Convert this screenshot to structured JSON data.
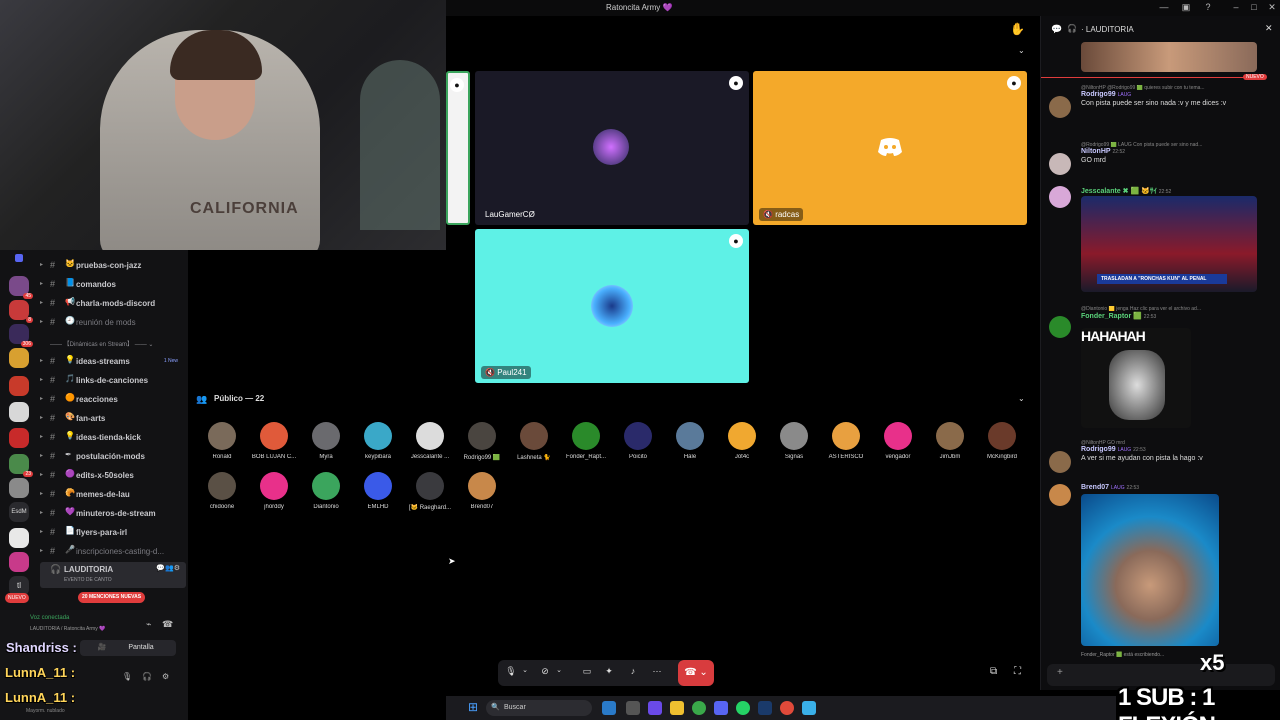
{
  "window": {
    "title": "Ratoncita Army 💜"
  },
  "webcam": {
    "shirt_text": "CALIFORNIA"
  },
  "server_rail": {
    "badges": [
      "45",
      "8",
      "306",
      "23",
      "99",
      "32",
      "",
      "2"
    ],
    "esda_label": "EsdM"
  },
  "channels": [
    {
      "label": "pruebas-con-jazz",
      "icon": "🐱"
    },
    {
      "label": "comandos",
      "icon": "📘"
    },
    {
      "label": "charla-mods-discord",
      "icon": "📢"
    },
    {
      "label": "reunión de mods",
      "icon": "🕘",
      "muted": true
    },
    {
      "label": "ideas-streams",
      "icon": "💡",
      "badge": "1 New"
    },
    {
      "label": "links-de-canciones",
      "icon": "🎵"
    },
    {
      "label": "reacciones",
      "icon": "🟠"
    },
    {
      "label": "fan-arts",
      "icon": "🎨"
    },
    {
      "label": "ideas-tienda-kick",
      "icon": "💡"
    },
    {
      "label": "postulación-mods",
      "icon": "✒"
    },
    {
      "label": "edits-x-50soles",
      "icon": "🟣"
    },
    {
      "label": "memes-de-lau",
      "icon": "🥐"
    },
    {
      "label": "minuteros-de-stream",
      "icon": "💜"
    },
    {
      "label": "flyers-para-irl",
      "icon": "📄"
    },
    {
      "label": "inscripciones-casting-d...",
      "icon": "🎤",
      "muted": true
    }
  ],
  "category_label": "【Dinámicas en Stream】",
  "active_channel": {
    "label": "LAUDITORIA",
    "sub": "EVENTO DE CANTO"
  },
  "mentions_pill": "20 MENCIONES NUEVAS",
  "nuevo_pill": "NUEVO",
  "voice_panel": {
    "connected": "Voz conectada",
    "path": "LAUDITORIA / Ratoncita Army 💜",
    "screen_label": "Pantalla"
  },
  "overlays": {
    "user1": "Shandriss :",
    "user2": "LunnA_11 :",
    "user3": "LunnA_11 :",
    "status": "Mayorm. nublado",
    "sub_flex": "1 SUB : 1 FLEXIÓN",
    "x5": "x5"
  },
  "stage": {
    "tiles": [
      {
        "name": "LauGamerCØ"
      },
      {
        "name": "radcas"
      },
      {
        "name": "Paul241"
      }
    ]
  },
  "audience": {
    "header": "Público — 22",
    "members": [
      {
        "name": "Ronald",
        "color": "#7a6a5a"
      },
      {
        "name": "BOB LUJAN C...",
        "color": "#e05a3a"
      },
      {
        "name": "Myra",
        "color": "#6a6a6e"
      },
      {
        "name": "keypibara",
        "color": "#3aa8c8"
      },
      {
        "name": "Jesscalante ...",
        "color": "#dcdcdc"
      },
      {
        "name": "Rodrigo99 🟩",
        "color": "#4a4540"
      },
      {
        "name": "Lashneta 🐈",
        "color": "#6a4a3a"
      },
      {
        "name": "Fonder_Rapt...",
        "color": "#2a8a2a"
      },
      {
        "name": "Poicito",
        "color": "#2a2a6a"
      },
      {
        "name": "Hale",
        "color": "#5a7a9a"
      },
      {
        "name": "Jot4c",
        "color": "#f0a830"
      },
      {
        "name": "Signas",
        "color": "#8a8a8a"
      },
      {
        "name": "ASTERISCO",
        "color": "#e8a040"
      },
      {
        "name": "vengador",
        "color": "#e8308a"
      },
      {
        "name": "JimJbm",
        "color": "#8a6a4a"
      },
      {
        "name": "McKingbird",
        "color": "#6a3a2a"
      },
      {
        "name": "chidoone",
        "color": "#5a5045"
      },
      {
        "name": "jhorddy",
        "color": "#e8308a"
      },
      {
        "name": "Diantonio",
        "color": "#3ba55d"
      },
      {
        "name": "EMLHD",
        "color": "#3a5ae8"
      },
      {
        "name": "[🐱 Raeghard...",
        "color": "#3a3a3e"
      },
      {
        "name": "Brend07",
        "color": "#c8884a"
      }
    ]
  },
  "chat": {
    "channel": "LAUDITORIA",
    "nuevo": "NUEVO",
    "messages": [
      {
        "reply": "@NiltonHP @Rodrigo99 🟩 quieres subir con tu tema...",
        "author": "Rodrigo99",
        "tag": "LAUG",
        "author_color": "#c8c8ff",
        "text": "Con pista puede ser sino nada :v y me dices :v"
      },
      {
        "reply": "@Rodrigo99 🟩 LAUG Con pista puede ser sino nad...",
        "author": "NiltonHP",
        "time": "22:52",
        "author_color": "#c8c8ff",
        "text": "GO mrd"
      },
      {
        "reply": "",
        "author": "Jesscalante ✖ 🟩 🐱ｻｲ",
        "time": "22:52",
        "author_color": "#5ad27a",
        "text": "",
        "image_caption": "TRASLADAN A \"RONCHAS KUN\" AL PENAL"
      },
      {
        "reply": "@Diantonio 🟨 jenga Haz clic para ver el archivo ad...",
        "author": "Fonder_Raptor 🟩",
        "time": "22:53",
        "author_color": "#5ad27a",
        "text": "",
        "image_caption": "HAHAHAH"
      },
      {
        "reply": "@NiltonHP GO mrd",
        "author": "Rodrigo99",
        "tag": "LAUG",
        "time": "22:53",
        "author_color": "#c8c8ff",
        "text": "A ver si me ayudan con pista la hago :v"
      },
      {
        "reply": "",
        "author": "Brend07",
        "tag": "LAUG",
        "time": "22:53",
        "author_color": "#c8c8ff",
        "text": ""
      }
    ],
    "typing": "Fonder_Raptor 🟩 está escribiendo..."
  },
  "taskbar": {
    "search_placeholder": "Buscar"
  },
  "colors": {
    "accent": "#5865f2",
    "danger": "#d83c3e",
    "tile_orange": "#f4a92a",
    "tile_cyan": "#5ef1e6"
  }
}
